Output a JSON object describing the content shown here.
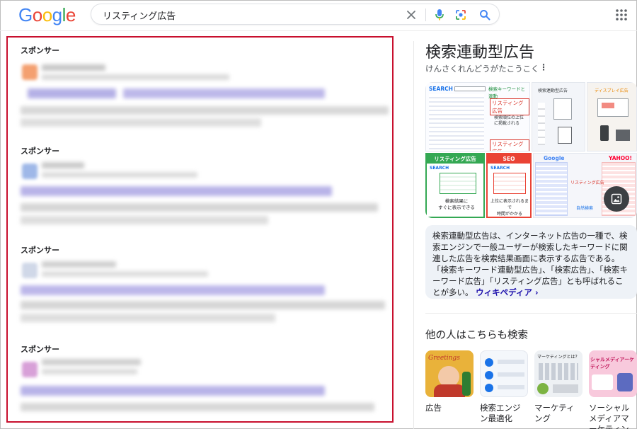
{
  "search": {
    "query": "リスティング広告",
    "logo_letters": [
      "G",
      "o",
      "o",
      "g",
      "l",
      "e"
    ],
    "logo_colors": [
      "#4285F4",
      "#EA4335",
      "#FBBC05",
      "#4285F4",
      "#34A853",
      "#EA4335"
    ],
    "clear_icon": "close-icon",
    "voice_icon": "mic-icon",
    "lens_icon": "camera-lens-icon",
    "search_icon": "search-icon"
  },
  "results": {
    "sponsored_label": "スポンサー",
    "ads_count_visible": 4,
    "highlight_color": "#c8102e"
  },
  "knowledge_panel": {
    "title": "検索連動型広告",
    "reading": "けんさくれんどうがたこうこく",
    "more_icon": "more-vert-icon",
    "images": {
      "tile1": {
        "search_label": "SEARCH",
        "keyword_label": "検索キーワードと連動",
        "listing_top": "リスティング広告",
        "organic_note": "検索順位の上位に掲載される",
        "listing_bottom": "リスティング広告"
      },
      "tile2": {
        "label": "検索連動型広告"
      },
      "tile3": {
        "label": "ディスプレイ広告"
      },
      "tile4": {
        "header": "リスティング広告",
        "search_label": "SEARCH",
        "caption_line1": "検索結果に",
        "caption_line2": "すぐに表示できる"
      },
      "tile5": {
        "header": "SEO",
        "search_label": "SEARCH",
        "caption_line1": "上位に表示されるまで",
        "caption_line2": "時間がかかる"
      },
      "tile6": {
        "brand1": "Google",
        "brand2": "YAHOO!",
        "listing": "リスティング広告",
        "organic": "自然検索"
      }
    },
    "image_button_icon": "image-icon",
    "description": "検索連動型広告は、インターネット広告の一種で、検索エンジンで一般ユーザーが検索したキーワードに関連した広告を検索結果画面に表示する広告である。「検索キーワード連動型広告」、「検索広告」、「検索キーワード広告」「リスティング広告」とも呼ばれることが多い。",
    "source_link": "ウィキペディア ›"
  },
  "people_also_search": {
    "title": "他の人はこちらも検索",
    "items": [
      {
        "label": "広告",
        "img_text": "Greetings"
      },
      {
        "label": "検索エンジン最適化",
        "img_text": ""
      },
      {
        "label": "マーケティング",
        "img_text": "マーケティングとは？"
      },
      {
        "label": "ソーシャルメディアマーケティング",
        "img_text": "シャルメディアーケティング"
      }
    ]
  }
}
